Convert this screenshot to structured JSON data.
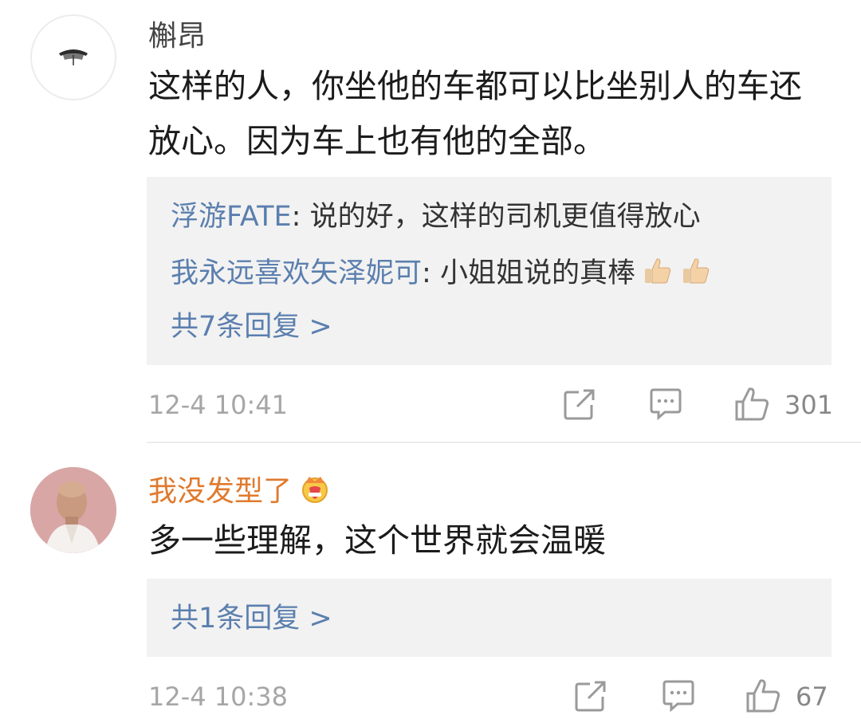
{
  "comments": [
    {
      "username": "槲昂",
      "username_color": "#444444",
      "avatar_icon": "umbrella-avatar",
      "text": "这样的人，你坐他的车都可以比坐别人的车还放心。因为车上也有他的全部。",
      "replies": [
        {
          "author": "浮游FATE",
          "sep": ": ",
          "text": "说的好，这样的司机更值得放心",
          "emoji": []
        },
        {
          "author": "我永远喜欢矢泽妮可",
          "sep": ": ",
          "text": "小姐姐说的真棒",
          "emoji": [
            "thumbs-up-icon",
            "thumbs-up-icon"
          ]
        }
      ],
      "more_replies": "共7条回复 >",
      "timestamp": "12-4 10:41",
      "like_count": "301"
    },
    {
      "username": "我没发型了",
      "username_color": "#e07a2e",
      "badge_icon": "crown-badge-icon",
      "avatar_icon": "person-avatar",
      "text": "多一些理解，这个世界就会温暖",
      "replies": [],
      "more_replies": "共1条回复 >",
      "timestamp": "12-4 10:38",
      "like_count": "67"
    }
  ],
  "colors": {
    "reply_author": "#5b7fae",
    "reply_box_bg": "#f2f2f2",
    "meta_gray": "#a6a6a6"
  }
}
